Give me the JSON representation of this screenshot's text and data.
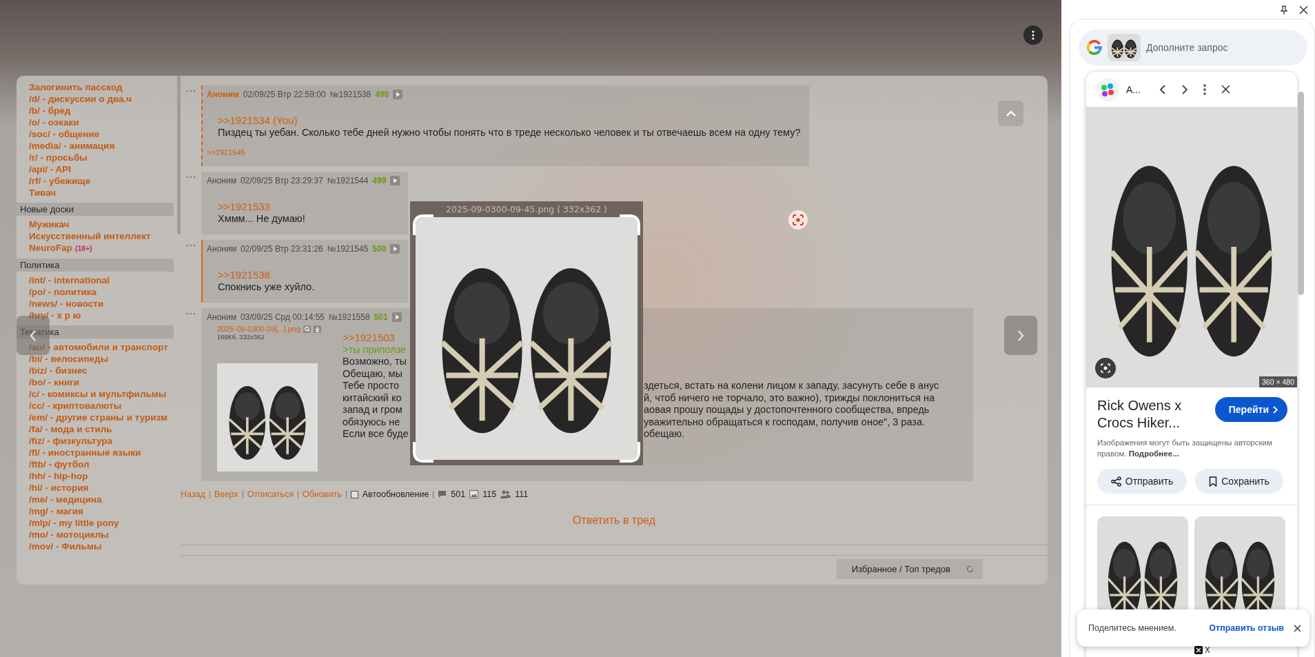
{
  "sidebar": {
    "groups": [
      {
        "items": [
          {
            "label": "Залогинить пасскод"
          },
          {
            "label": "/d/ - дискуссии о два.ч"
          },
          {
            "label": "/b/ - бред"
          },
          {
            "label": "/o/ - оэкаки"
          },
          {
            "label": "/soc/ - общение"
          },
          {
            "label": "/media/ - анимация"
          },
          {
            "label": "/r/ - просьбы"
          },
          {
            "label": "/api/ - API"
          },
          {
            "label": "/rf/ - убежище"
          },
          {
            "label": "Тивач"
          }
        ]
      },
      {
        "heading": "Новые доски",
        "items": [
          {
            "label": "Мужикач"
          },
          {
            "label": "Искусственный интеллект"
          },
          {
            "label": "NeuroFap",
            "badge": "(18+)"
          }
        ]
      },
      {
        "heading": "Политика",
        "items": [
          {
            "label": "/int/ - international"
          },
          {
            "label": "/po/ - политика"
          },
          {
            "label": "/news/ - новости"
          },
          {
            "label": "/hry/ - х р ю"
          }
        ]
      },
      {
        "heading": "Тематика",
        "items": [
          {
            "label": "/au/ - автомобили и транспорт"
          },
          {
            "label": "/bi/ - велосипеды"
          },
          {
            "label": "/biz/ - бизнес"
          },
          {
            "label": "/bo/ - книги"
          },
          {
            "label": "/c/ - комиксы и мультфильмы"
          },
          {
            "label": "/cc/ - криптовалюты"
          },
          {
            "label": "/em/ - другие страны и туризм"
          },
          {
            "label": "/fa/ - мода и стиль"
          },
          {
            "label": "/fiz/ - физкультура"
          },
          {
            "label": "/fl/ - иностранные языки"
          },
          {
            "label": "/ftb/ - футбол"
          },
          {
            "label": "/hh/ - hip-hop"
          },
          {
            "label": "/hi/ - история"
          },
          {
            "label": "/me/ - медицина"
          },
          {
            "label": "/mg/ - магия"
          },
          {
            "label": "/mlp/ - my little pony"
          },
          {
            "label": "/mo/ - мотоциклы"
          },
          {
            "label": "/mov/ - Фильмы"
          }
        ]
      }
    ]
  },
  "thread": {
    "posts": [
      {
        "author": "Аноним",
        "author_highlight": true,
        "date": "02/09/25 Втр 22:59:00",
        "number": "№1921538",
        "count": "498",
        "kind": "reply-to-you",
        "lines": [
          {
            "kind": "link",
            "text": ">>1921534 (You)"
          },
          {
            "kind": "text",
            "text": "Пиздец ты уебан. Сколько тебе дней нужно чтобы понять что в треде несколько человек и ты отвечаешь всем на одну тему?"
          }
        ],
        "replies": [
          ">>1921545"
        ]
      },
      {
        "author": "Аноним",
        "author_highlight": false,
        "date": "02/09/25 Втр 23:29:37",
        "number": "№1921544",
        "count": "499",
        "kind": "plain",
        "lines": [
          {
            "kind": "link",
            "text": ">>1921533"
          },
          {
            "kind": "text",
            "text": "Хммм... Не думаю!"
          }
        ]
      },
      {
        "author": "Аноним",
        "author_highlight": false,
        "date": "02/09/25 Втр 23:31:26",
        "number": "№1921545",
        "count": "500",
        "kind": "reply",
        "lines": [
          {
            "kind": "link",
            "text": ">>1921538"
          },
          {
            "kind": "text",
            "text": "Спокнись уже хуйло."
          }
        ]
      },
      {
        "author": "Аноним",
        "author_highlight": false,
        "date": "03/09/25 Срд 00:14:55",
        "number": "№1921558",
        "count": "501",
        "kind": "plain",
        "file": {
          "name": "2025-09-0300-09[...].png",
          "info": "168Кб, 332x362"
        },
        "lines": [
          {
            "kind": "link",
            "text": ">>1921503"
          },
          {
            "kind": "quote",
            "text": ">ты приползе"
          },
          {
            "kind": "text",
            "text": "Возможно, ты"
          },
          {
            "kind": "text",
            "text": "Обещаю, мы"
          },
          {
            "kind": "text",
            "text": "Тебе просто",
            "continued": "здеться, встать на колени лицом к западу, засунуть себе в анус"
          },
          {
            "kind": "text",
            "text": "китайский ко",
            "continued": "й, чтоб ничего не торчало, это важно), трижды поклониться на"
          },
          {
            "kind": "text",
            "text": "запад и гром",
            "continued": "аовая прошу пощады у достопочтенного сообщества, впредь"
          },
          {
            "kind": "text",
            "text": "обязуюсь не",
            "continued": "уважительно обращаться к господам, получив оное\", 3 раза."
          },
          {
            "kind": "text",
            "text": "Если все буде",
            "continued": "обещаю."
          }
        ]
      }
    ],
    "footer": {
      "links": [
        "Назад",
        "Вверх",
        "Отписаться",
        "Обновить"
      ],
      "autoupdate": {
        "label": "Автообновление",
        "checked": false
      },
      "stats": {
        "posts": "501",
        "images": "115",
        "posters": "111"
      },
      "reply": "Ответить в тред",
      "bottom_tab": "Избранное / Топ тредов"
    }
  },
  "image_viewer": {
    "title": "2025-09-0300-09-45.png ( 332x362 )"
  },
  "lens_panel": {
    "search": {
      "placeholder": "Дополните запрос"
    },
    "result": {
      "source": "А...",
      "image_size": "360 × 480",
      "title": "Rick Owens x Crocs Hiker...",
      "visit": "Перейти",
      "notice": "Изображения могут быть защищены авторским правом. **Подробнее...**",
      "actions": [
        "Отправить",
        "Сохранить"
      ]
    },
    "feedback": {
      "text": "Поделитесь мнением.",
      "action": "Отправить отзыв"
    },
    "partial_source": "X"
  }
}
